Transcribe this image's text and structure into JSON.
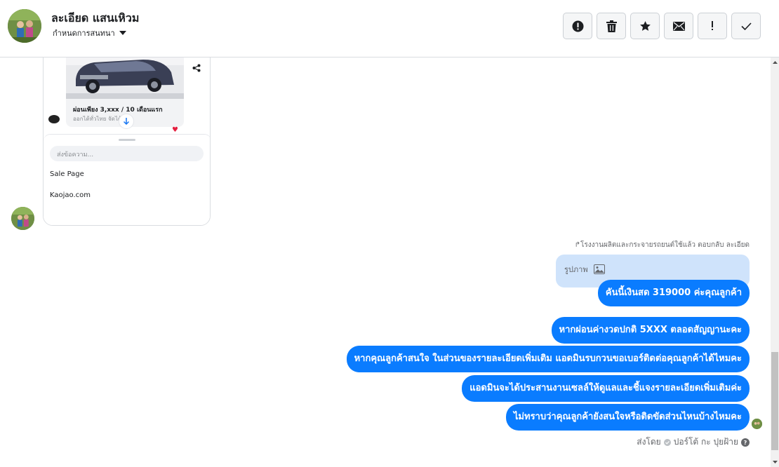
{
  "header": {
    "contact_name": "ละเอียด แสนเหิวม",
    "subtitle": "กำหนดการสนทนา",
    "toolbar": [
      {
        "name": "report-button",
        "icon": "alert-circle-icon"
      },
      {
        "name": "delete-button",
        "icon": "trash-icon"
      },
      {
        "name": "star-button",
        "icon": "star-icon"
      },
      {
        "name": "mail-button",
        "icon": "envelope-icon"
      },
      {
        "name": "important-button",
        "icon": "exclamation-icon"
      },
      {
        "name": "done-button",
        "icon": "check-icon"
      }
    ]
  },
  "phone_preview": {
    "car_title": "ผ่อนเพียง 3,xxx / 10 เดือนแรก",
    "car_sub": "ออกได้ทั่วไทย จัดได้...",
    "input_placeholder": "ส่งข้อความ...",
    "links": [
      "Sale Page",
      "Kaojao.com"
    ]
  },
  "thread": {
    "reply_note": "↱โรงงานผลิตและกระจายรถยนต์ใช้แล้ว ตอบกลับ ละเอียด",
    "quoted": "รูปภาพ",
    "messages": [
      "คันนี้เงินสด 319000 ค่ะคุณลูกค้า",
      "หากผ่อนค่างวดปกติ 5XXX ตลอดสัญญานะคะ",
      "หากคุณลูกค้าสนใจ ในส่วนของรายละเอียดเพิ่มเติม แอดมินรบกวนขอเบอร์ติดต่อคุณลูกค้าได้ไหมคะ",
      "แอดมินจะได้ประสานงานเซลล์ให้ดูแลและชี้แจงรายละเอียดเพิ่มเติมค่ะ",
      "ไม่ทราบว่าคุณลูกค้ายังสนใจหรือติดขัดส่วนไหนบ้างไหมคะ"
    ],
    "sent_by_label": "ส่งโดย",
    "sender": "ปอร์โต้ กะ ปุยฝ้าย"
  },
  "colors": {
    "bubble": "#0a7cff",
    "quote_bg": "#cfe3fb",
    "text_secondary": "#65676b"
  }
}
